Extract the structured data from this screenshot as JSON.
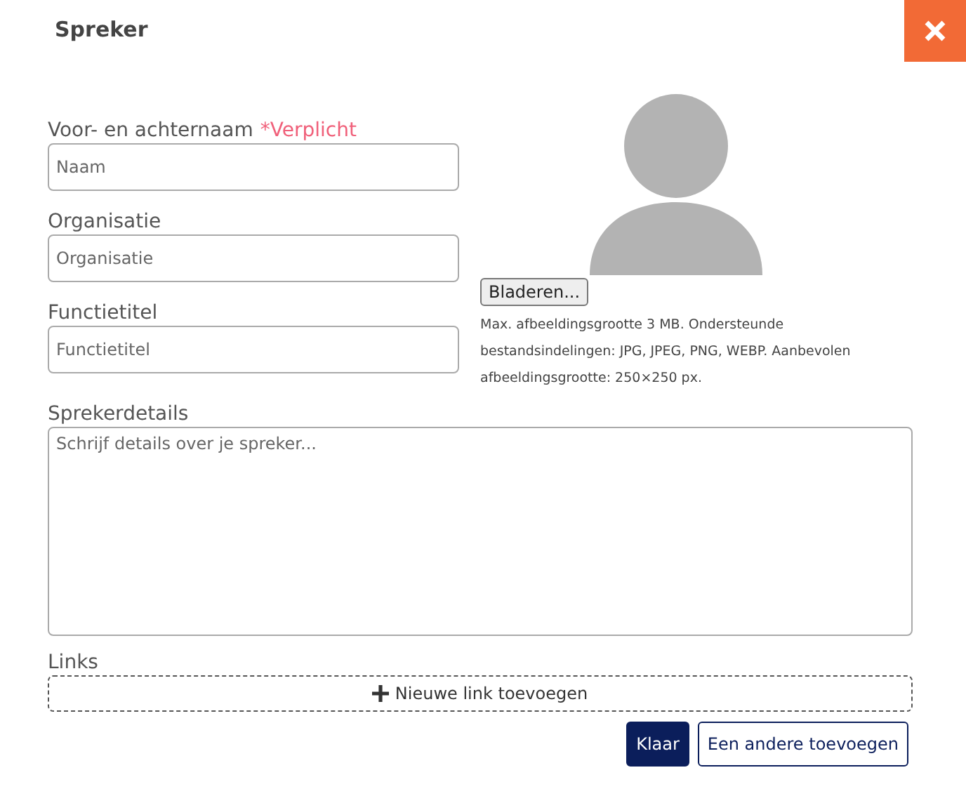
{
  "dialog": {
    "title": "Spreker"
  },
  "fields": [
    {
      "label": "Voor- en achternaam",
      "required_note": "*Verplicht",
      "placeholder": "Naam"
    },
    {
      "label": "Organisatie",
      "placeholder": "Organisatie"
    },
    {
      "label": "Functietitel",
      "placeholder": "Functietitel"
    }
  ],
  "photo": {
    "browse_button": "Bladeren...",
    "help": "Max. afbeeldingsgrootte 3 MB. Ondersteunde bestandsindelingen: JPG, JPEG, PNG, WEBP. Aanbevolen afbeeldingsgrootte: 250×250 px."
  },
  "details": {
    "label": "Sprekerdetails",
    "placeholder": "Schrijf details over je spreker..."
  },
  "links": {
    "label": "Links",
    "add_button": "Nieuwe link toevoegen"
  },
  "actions": [
    {
      "label": "Klaar",
      "kind": "primary"
    },
    {
      "label": "Een andere toevoegen",
      "kind": "secondary"
    }
  ]
}
